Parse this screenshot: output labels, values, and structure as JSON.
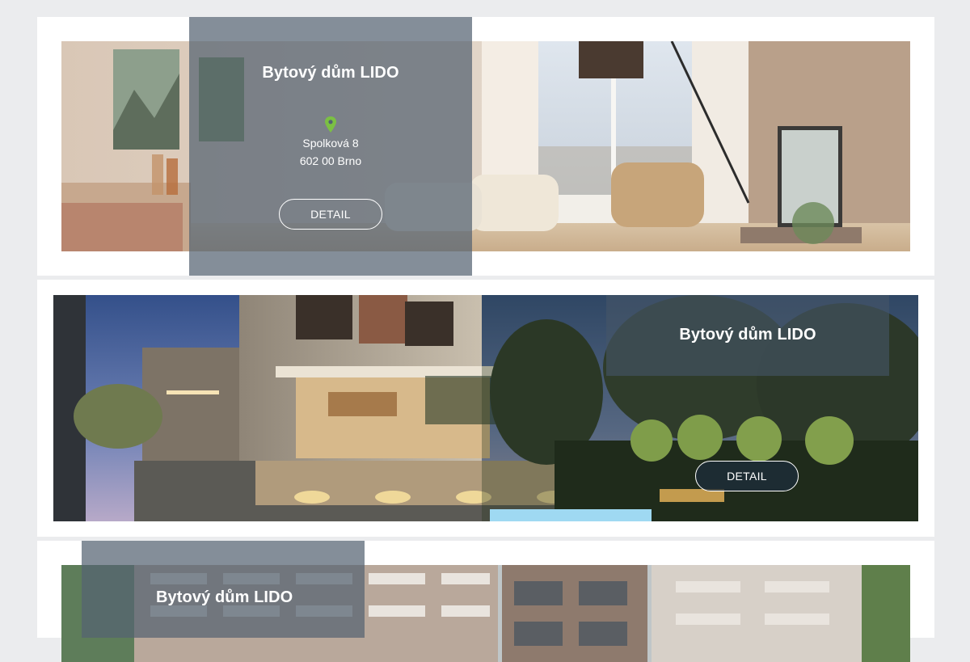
{
  "listings": [
    {
      "title": "Bytový dům LIDO",
      "address_line1": "Spolková 8",
      "address_line2": "602 00 Brno",
      "button_label": "DETAIL"
    },
    {
      "title": "Bytový dům LIDO",
      "button_label": "DETAIL"
    },
    {
      "title": "Bytový dům LIDO"
    }
  ],
  "colors": {
    "page_bg": "#ebecee",
    "card_bg": "#ffffff",
    "overlay": "#546372",
    "pin": "#7bc043"
  },
  "icons": [
    "map-pin-icon"
  ]
}
